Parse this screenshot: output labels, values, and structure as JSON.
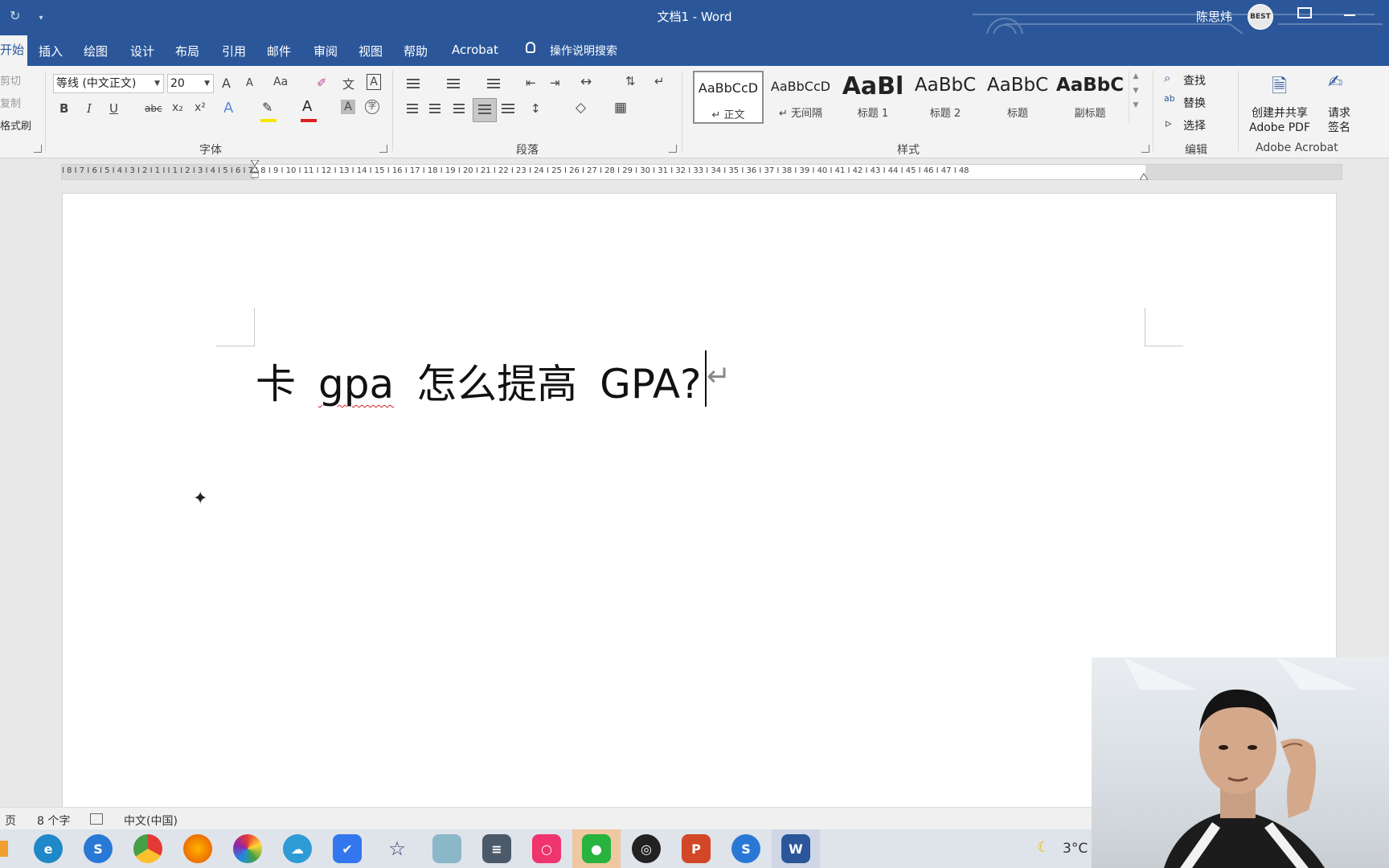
{
  "window": {
    "title": "文档1 - Word",
    "user_name": "陈思炜",
    "avatar_text": "BEST",
    "qat_icons": [
      "autosave-icon",
      "customize-qat-icon"
    ]
  },
  "tabs": {
    "home": "开始",
    "items": [
      "插入",
      "绘图",
      "设计",
      "布局",
      "引用",
      "邮件",
      "审阅",
      "视图",
      "帮助",
      "Acrobat"
    ],
    "tell_me": "操作说明搜索"
  },
  "clipboard": {
    "cut": "剪切",
    "copy": "复制",
    "format_painter": "格式刷"
  },
  "font_group": {
    "label": "字体",
    "font_name": "等线 (中文正文)",
    "font_size": "20",
    "bold": "B",
    "italic": "I",
    "underline": "U",
    "strikethrough": "abc",
    "subscript": "x₂",
    "superscript": "x²",
    "grow": "A",
    "shrink": "A",
    "change_case": "Aa",
    "phonetic": "文",
    "char_border": "A",
    "text_effect": "A",
    "font_color": "A",
    "char_shading": "A",
    "enclose": "字",
    "font_color_value": "#e02020",
    "highlight_color_value": "#f5e600"
  },
  "paragraph_group": {
    "label": "段落"
  },
  "styles_group": {
    "label": "样式",
    "styles": [
      {
        "preview": "AaBbCcD",
        "name": "↵ 正文"
      },
      {
        "preview": "AaBbCcD",
        "name": "↵ 无间隔"
      },
      {
        "preview": "AaBl",
        "name": "标题 1"
      },
      {
        "preview": "AaBbC",
        "name": "标题 2"
      },
      {
        "preview": "AaBbC",
        "name": "标题"
      },
      {
        "preview": "AaBbC",
        "name": "副标题"
      }
    ]
  },
  "editing_group": {
    "label": "编辑",
    "find": "查找",
    "replace": "替换",
    "select": "选择"
  },
  "acrobat_group": {
    "label": "Adobe Acrobat",
    "create_share_line1": "创建并共享",
    "create_share_line2": "Adobe PDF",
    "request_sign_line1": "请求",
    "request_sign_line2": "签名"
  },
  "ruler": {
    "text": "I 8 I 7 I 6 I 5 I 4 I 3 I 2 I 1 I   I 1 I 2 I 3 I 4 I 5 I 6 I 7 I 8 I 9 I 10 I 11 I 12 I 13 I 14 I 15 I 16 I 17 I 18 I 19 I 20 I 21 I 22 I 23 I 24 I 25 I 26 I 27 I 28 I 29 I 30 I 31 I 32 I 33 I 34 I 35 I 36 I 37 I 38 I 39 I 40 I 41 I 42 I 43 I 44 I 45 I 46 I 47 I 48"
  },
  "document": {
    "words": [
      "卡",
      "gpa",
      "怎么提高",
      "GPA?"
    ],
    "paragraph_mark": "↵"
  },
  "status_bar": {
    "page": "页",
    "word_count": "8 个字",
    "language": "中文(中国)"
  },
  "taskbar": {
    "apps": [
      "edge-icon",
      "sogou-icon",
      "chrome-icon",
      "firefox-icon",
      "photos-icon",
      "onedrive-icon",
      "feishu-icon",
      "star-app-icon",
      "notes-app-icon",
      "calculator-icon",
      "camera-app-icon",
      "wechat-icon",
      "obs-icon",
      "powerpoint-icon",
      "sogou-browser-icon",
      "word-icon"
    ],
    "weather": "3°C"
  }
}
